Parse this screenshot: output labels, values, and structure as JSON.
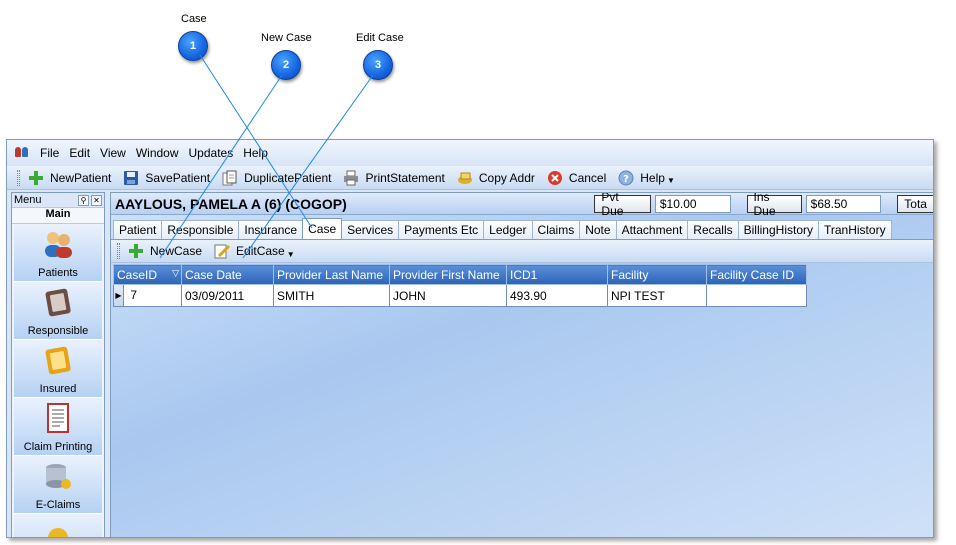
{
  "callouts": [
    {
      "number": "1",
      "label": "Case"
    },
    {
      "number": "2",
      "label": "New Case"
    },
    {
      "number": "3",
      "label": "Edit Case"
    }
  ],
  "menubar": {
    "items": [
      "File",
      "Edit",
      "View",
      "Window",
      "Updates",
      "Help"
    ]
  },
  "toolbar": {
    "new_patient": "NewPatient",
    "save_patient": "SavePatient",
    "duplicate_patient": "DuplicatePatient",
    "print_statement": "PrintStatement",
    "copy_addr": "Copy Addr",
    "cancel": "Cancel",
    "help": "Help"
  },
  "sidemenu": {
    "header": "Menu",
    "section": "Main",
    "items": [
      "Patients",
      "Responsible",
      "Insured",
      "Claim Printing",
      "E-Claims"
    ]
  },
  "patient": {
    "name": "AAYLOUS, PAMELA A (6) (COGOP)",
    "pvt_due_label": "Pvt Due",
    "pvt_due_value": "$10.00",
    "ins_due_label": "Ins Due",
    "ins_due_value": "$68.50",
    "total_label": "Tota"
  },
  "tabs": [
    "Patient",
    "Responsible",
    "Insurance",
    "Case",
    "Services",
    "Payments Etc",
    "Ledger",
    "Claims",
    "Note",
    "Attachment",
    "Recalls",
    "BillingHistory",
    "TranHistory"
  ],
  "active_tab": "Case",
  "subtoolbar": {
    "new_case": "NewCase",
    "edit_case": "EditCase"
  },
  "grid": {
    "columns": [
      "CaseID",
      "Case Date",
      "Provider Last Name",
      "Provider First Name",
      "ICD1",
      "Facility",
      "Facility Case ID"
    ],
    "rows": [
      [
        "7",
        "03/09/2011",
        "SMITH",
        "JOHN",
        "493.90",
        "NPI TEST",
        ""
      ]
    ]
  },
  "colors": {
    "callout_blue": "#1565e0",
    "grid_header": "#2c64b8",
    "callout_line": "#1e88e5"
  }
}
